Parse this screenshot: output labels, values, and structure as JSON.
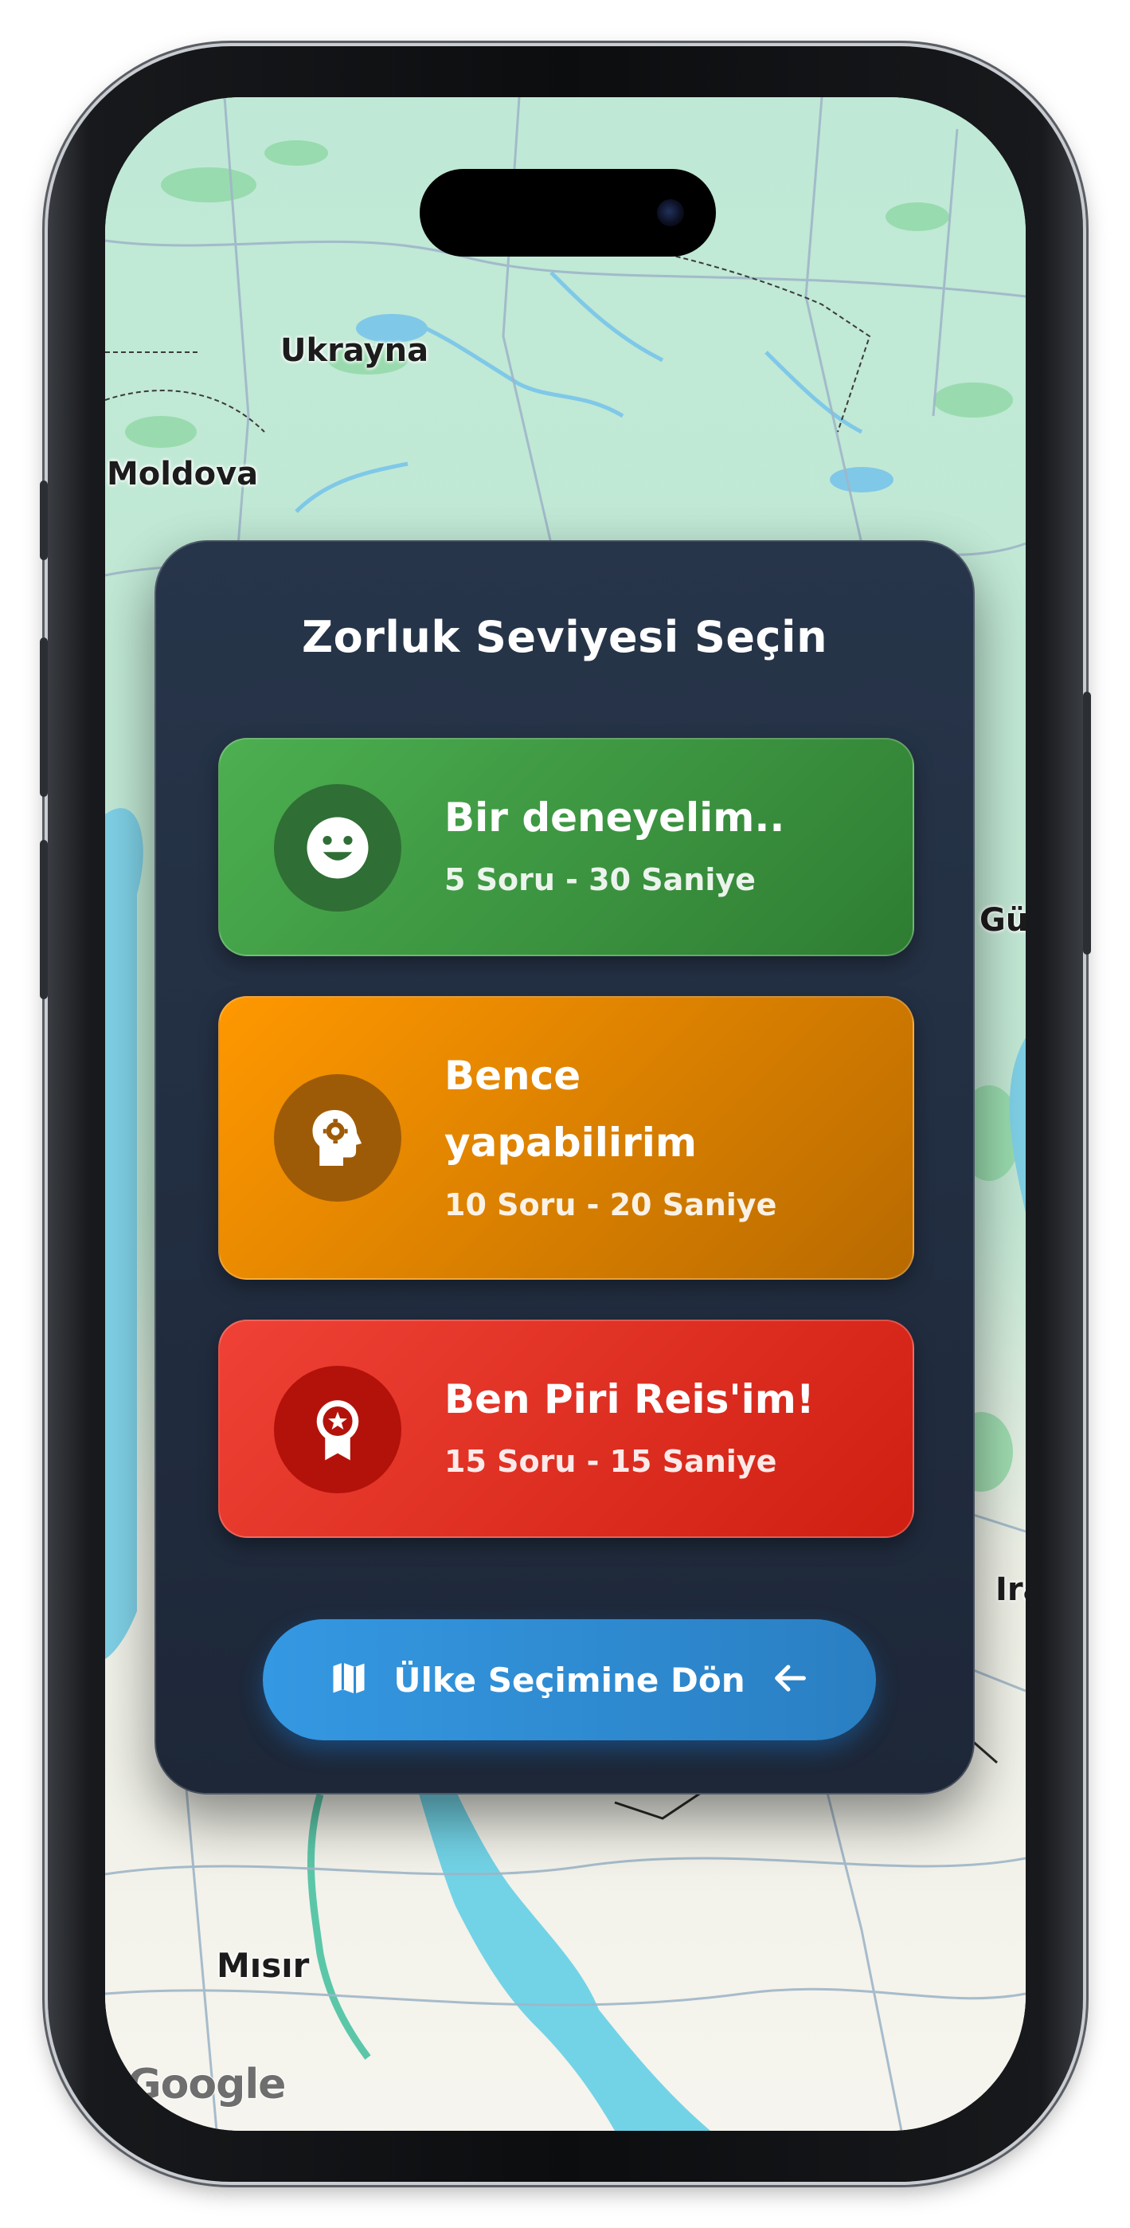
{
  "map": {
    "labels": {
      "ukraine": "Ukrayna",
      "moldova": "Moldova",
      "egypt": "Mısır",
      "georgia_partial": "Gü",
      "iraq_partial": "Ira"
    },
    "attribution": "Google"
  },
  "dialog": {
    "title": "Zorluk Seviyesi Seçin",
    "levels": [
      {
        "title": "Bir deneyelim..",
        "subtitle": "5 Soru - 30 Saniye",
        "icon": "smile-icon",
        "color": "#4caf50"
      },
      {
        "title": "Bence yapabilirim",
        "subtitle": "10 Soru - 20 Saniye",
        "icon": "head-gear-icon",
        "color": "#ff9800"
      },
      {
        "title": "Ben Piri Reis'im!",
        "subtitle": "15 Soru - 15 Saniye",
        "icon": "award-badge-icon",
        "color": "#e53935"
      }
    ],
    "back_button": {
      "label": "Ülke Seçimine Dön",
      "icon": "map-icon",
      "trailing_icon": "arrow-left-icon",
      "color": "#3498db"
    }
  }
}
